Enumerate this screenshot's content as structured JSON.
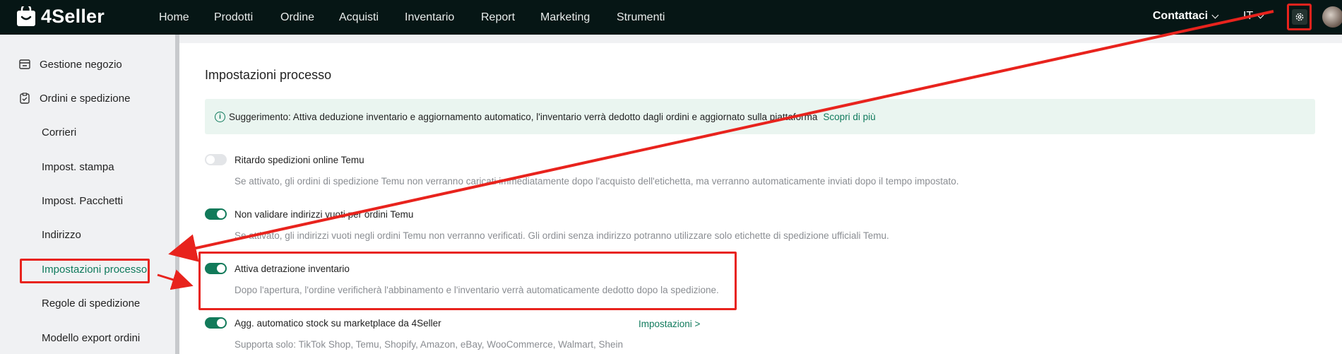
{
  "header": {
    "brand": "4Seller",
    "nav": [
      "Home",
      "Prodotti",
      "Ordine",
      "Acquisti",
      "Inventario",
      "Report",
      "Marketing",
      "Strumenti"
    ],
    "contact_label": "Contattaci",
    "language": "IT"
  },
  "sidebar": {
    "sections": [
      {
        "label": "Gestione negozio",
        "icon": "store-icon"
      },
      {
        "label": "Ordini e spedizione",
        "icon": "clipboard-icon"
      }
    ],
    "items": [
      {
        "label": "Corrieri"
      },
      {
        "label": "Impost. stampa"
      },
      {
        "label": "Impost. Pacchetti"
      },
      {
        "label": "Indirizzo"
      },
      {
        "label": "Impostazioni processo",
        "active": true
      },
      {
        "label": "Regole di spedizione"
      },
      {
        "label": "Modello export ordini"
      }
    ]
  },
  "main": {
    "title": "Impostazioni processo",
    "tip": {
      "text": "Suggerimento: Attiva deduzione inventario e aggiornamento automatico, l'inventario verrà dedotto dagli ordini e aggiornato sulla piattaforma",
      "link": "Scopri di più"
    },
    "settings": [
      {
        "label": "Ritardo spedizioni online Temu",
        "enabled": false,
        "description": "Se attivato, gli ordini di spedizione Temu non verranno caricati immediatamente dopo l'acquisto dell'etichetta, ma verranno automaticamente inviati dopo il tempo impostato."
      },
      {
        "label": "Non validare indirizzi vuoti per ordini Temu",
        "enabled": true,
        "description": "Se attivato, gli indirizzi vuoti negli ordini Temu non verranno verificati. Gli ordini senza indirizzo potranno utilizzare solo etichette di spedizione ufficiali Temu."
      },
      {
        "label": "Attiva detrazione inventario",
        "enabled": true,
        "description": "Dopo l'apertura, l'ordine verificherà l'abbinamento e l'inventario verrà automaticamente dedotto dopo la spedizione."
      },
      {
        "label": "Agg. automatico stock su marketplace da 4Seller",
        "enabled": true,
        "description": "Supporta solo: TikTok Shop, Temu, Shopify, Amazon, eBay, WooCommerce, Walmart, Shein",
        "link": "Impostazioni >"
      }
    ]
  },
  "colors": {
    "accent": "#107a5c",
    "annotation": "#e8231d",
    "topbar": "#061615"
  }
}
